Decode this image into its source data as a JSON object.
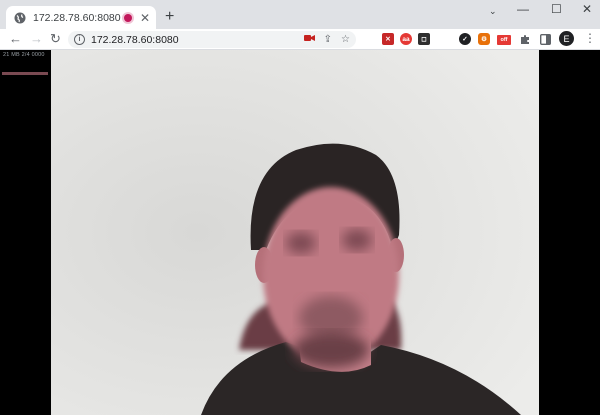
{
  "tab": {
    "title": "172.28.78.60:8080",
    "favicon": "globe-icon",
    "recording_indicator": "recording-dot-icon",
    "close_icon": "close-icon"
  },
  "window": {
    "minimize_icon": "minimize-icon",
    "maximize_icon": "maximize-icon",
    "close_icon": "close-icon"
  },
  "toolbar": {
    "back_icon": "back-arrow-icon",
    "forward_icon": "forward-arrow-icon",
    "reload_icon": "reload-icon",
    "url": "172.28.78.60:8080",
    "omnibox_icons": [
      "camera-icon",
      "share-icon",
      "star-icon"
    ],
    "extensions": [
      {
        "name": "ext-sensor-icon",
        "color": "#d32f2f",
        "label": "✕"
      },
      {
        "name": "ext-red-circle-icon",
        "color": "#e53935",
        "label": "aa"
      },
      {
        "name": "ext-pocket-icon",
        "color": "#2f2f2f",
        "label": "◻"
      },
      {
        "name": "ext-check-icon",
        "color": "#202124",
        "label": "✓"
      },
      {
        "name": "ext-gear-icon",
        "color": "#e8710a",
        "label": "⚙"
      },
      {
        "name": "ext-off-badge-icon",
        "color": "#e53935",
        "label": "off"
      },
      {
        "name": "extensions-puzzle-icon",
        "color": "#5f6368",
        "label": ""
      },
      {
        "name": "side-panel-icon",
        "color": "#5f6368",
        "label": ""
      }
    ],
    "profile_initial": "E"
  },
  "content": {
    "side_text": "21 MB 2/4 0000",
    "video_stream": "webcam-video-feed"
  }
}
